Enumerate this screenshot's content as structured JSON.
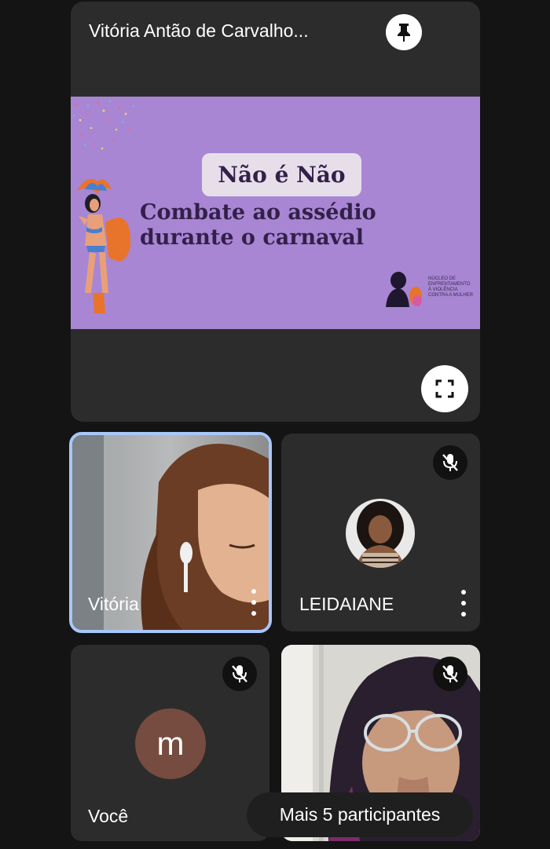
{
  "presentation": {
    "presenter_name": "Vitória Antão de Carvalho...",
    "slide": {
      "badge": "Não é Não",
      "headline_line1": "Combate ao assédio",
      "headline_line2": "durante o carnaval",
      "org_line1": "NÚCLEO DE",
      "org_line2": "ENFRENTAMENTO",
      "org_line3": "À VIOLÊNCIA",
      "org_line4": "CONTRA A MULHER"
    },
    "pin_icon": "pin-icon",
    "fullscreen_icon": "fullscreen-icon"
  },
  "participants": [
    {
      "name": "Vitória",
      "muted": false,
      "active_speaker": true,
      "video": true
    },
    {
      "name": "LEIDAIANE",
      "muted": true,
      "video": false,
      "avatar": "photo"
    },
    {
      "name": "Você",
      "muted": true,
      "video": false,
      "avatar_letter": "m",
      "avatar_color": "#754c3f"
    },
    {
      "name": "",
      "muted": true,
      "video": true
    }
  ],
  "more_participants": "Mais 5 participantes",
  "colors": {
    "background": "#141414",
    "tile": "#2c2c2c",
    "active_border": "#a8c7fa",
    "slide_bg": "#a886d3",
    "slide_text": "#33204a"
  }
}
